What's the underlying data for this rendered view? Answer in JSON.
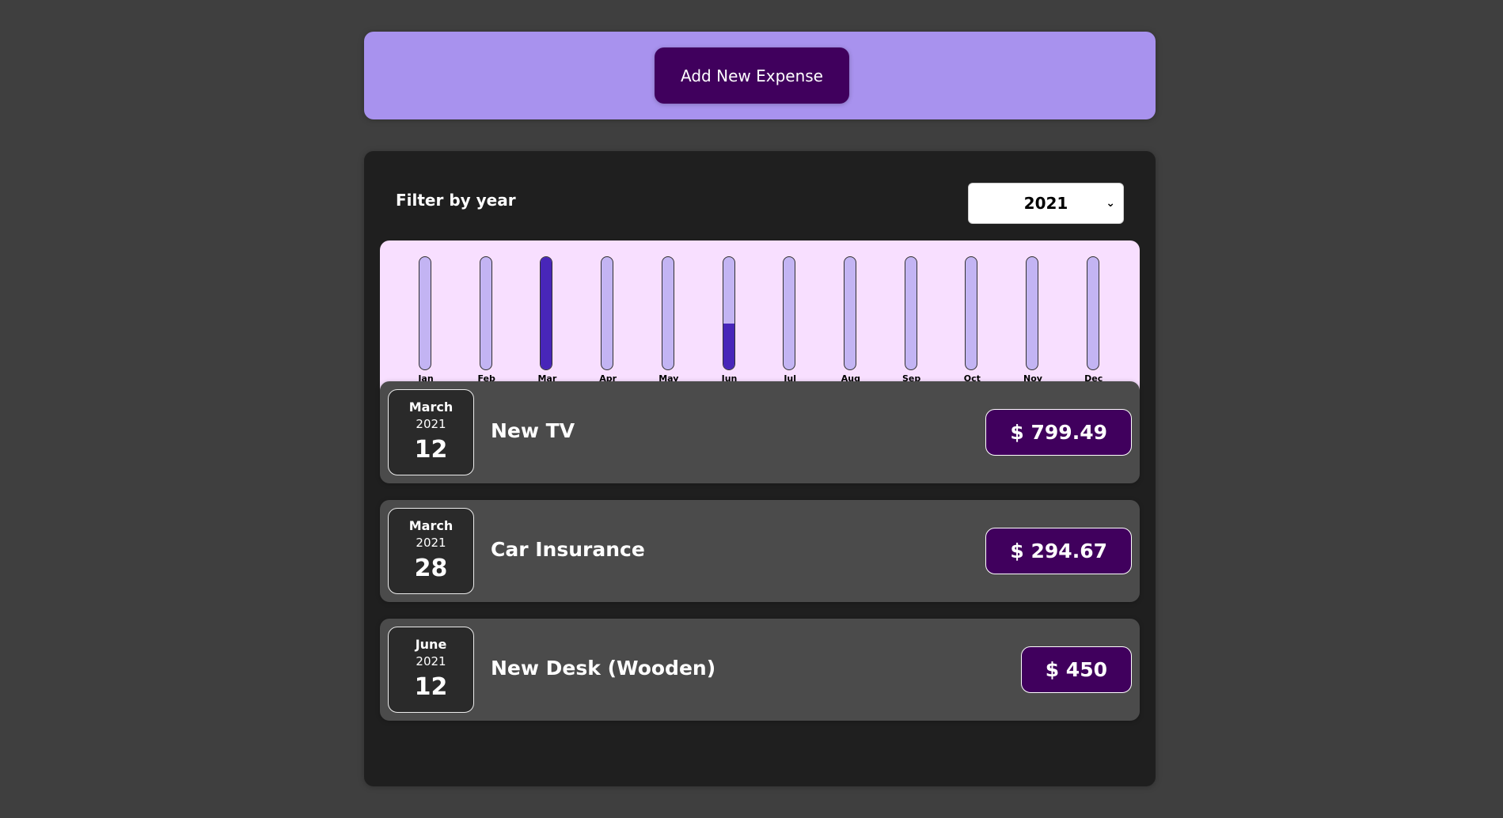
{
  "new_expense": {
    "button_label": "Add New Expense"
  },
  "filter": {
    "label": "Filter by year",
    "selected_year": "2021",
    "chevron": "chevron-down-icon"
  },
  "chart_data": {
    "type": "bar",
    "categories": [
      "Jan",
      "Feb",
      "Mar",
      "Apr",
      "May",
      "Jun",
      "Jul",
      "Aug",
      "Sep",
      "Oct",
      "Nov",
      "Dec"
    ],
    "values": [
      0,
      0,
      1094.16,
      0,
      0,
      450,
      0,
      0,
      0,
      0,
      0,
      0
    ],
    "max": 1094.16,
    "colors": {
      "fill": "#4826b9",
      "track": "#c3b4f3",
      "background": "#f8dfff"
    }
  },
  "expenses": [
    {
      "month": "March",
      "year": "2021",
      "day": "12",
      "title": "New TV",
      "amount": "$ 799.49"
    },
    {
      "month": "March",
      "year": "2021",
      "day": "28",
      "title": "Car Insurance",
      "amount": "$ 294.67"
    },
    {
      "month": "June",
      "year": "2021",
      "day": "12",
      "title": "New Desk (Wooden)",
      "amount": "$ 450"
    }
  ],
  "colors": {
    "page_bg": "#3f3f3f",
    "header_card": "#a892ee",
    "button": "#40005d",
    "panel": "#1f1f1f",
    "item": "#4b4b4b"
  }
}
